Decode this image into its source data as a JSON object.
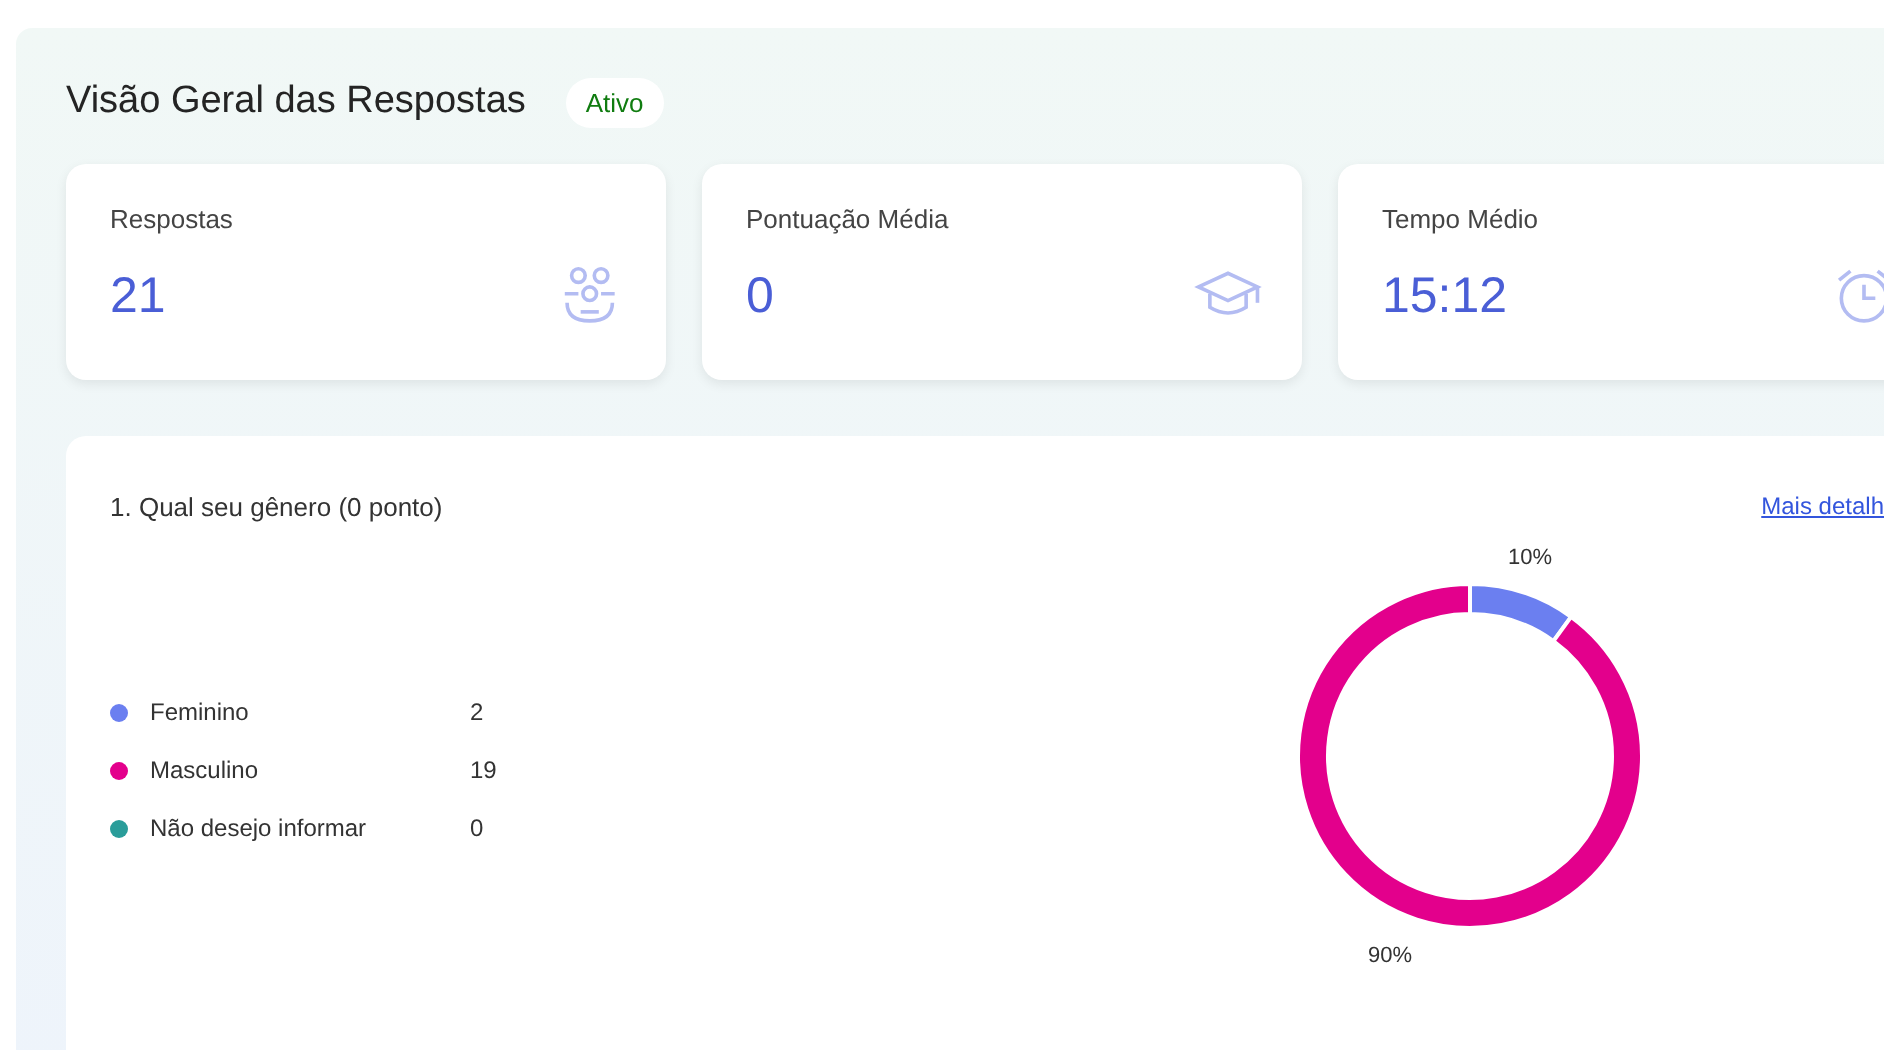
{
  "header": {
    "title": "Visão Geral das Respostas",
    "status": "Ativo"
  },
  "stats": [
    {
      "label": "Respostas",
      "value": "21",
      "kind": "people"
    },
    {
      "label": "Pontuação Média",
      "value": "0",
      "kind": "cap"
    },
    {
      "label": "Tempo Médio",
      "value": "15:12",
      "kind": "clock"
    }
  ],
  "question": {
    "title": "1. Qual seu gênero (0 ponto)",
    "link": "Mais detalh",
    "legend": [
      {
        "label": "Feminino",
        "count": "2",
        "color": "#6b7ff0"
      },
      {
        "label": "Masculino",
        "count": "19",
        "color": "#e3008c"
      },
      {
        "label": "Não desejo informar",
        "count": "0",
        "color": "#2a9d9a"
      }
    ],
    "chart_data": {
      "type": "donut",
      "values": [
        10,
        90
      ],
      "value_labels": [
        "10%",
        "90%"
      ]
    }
  }
}
